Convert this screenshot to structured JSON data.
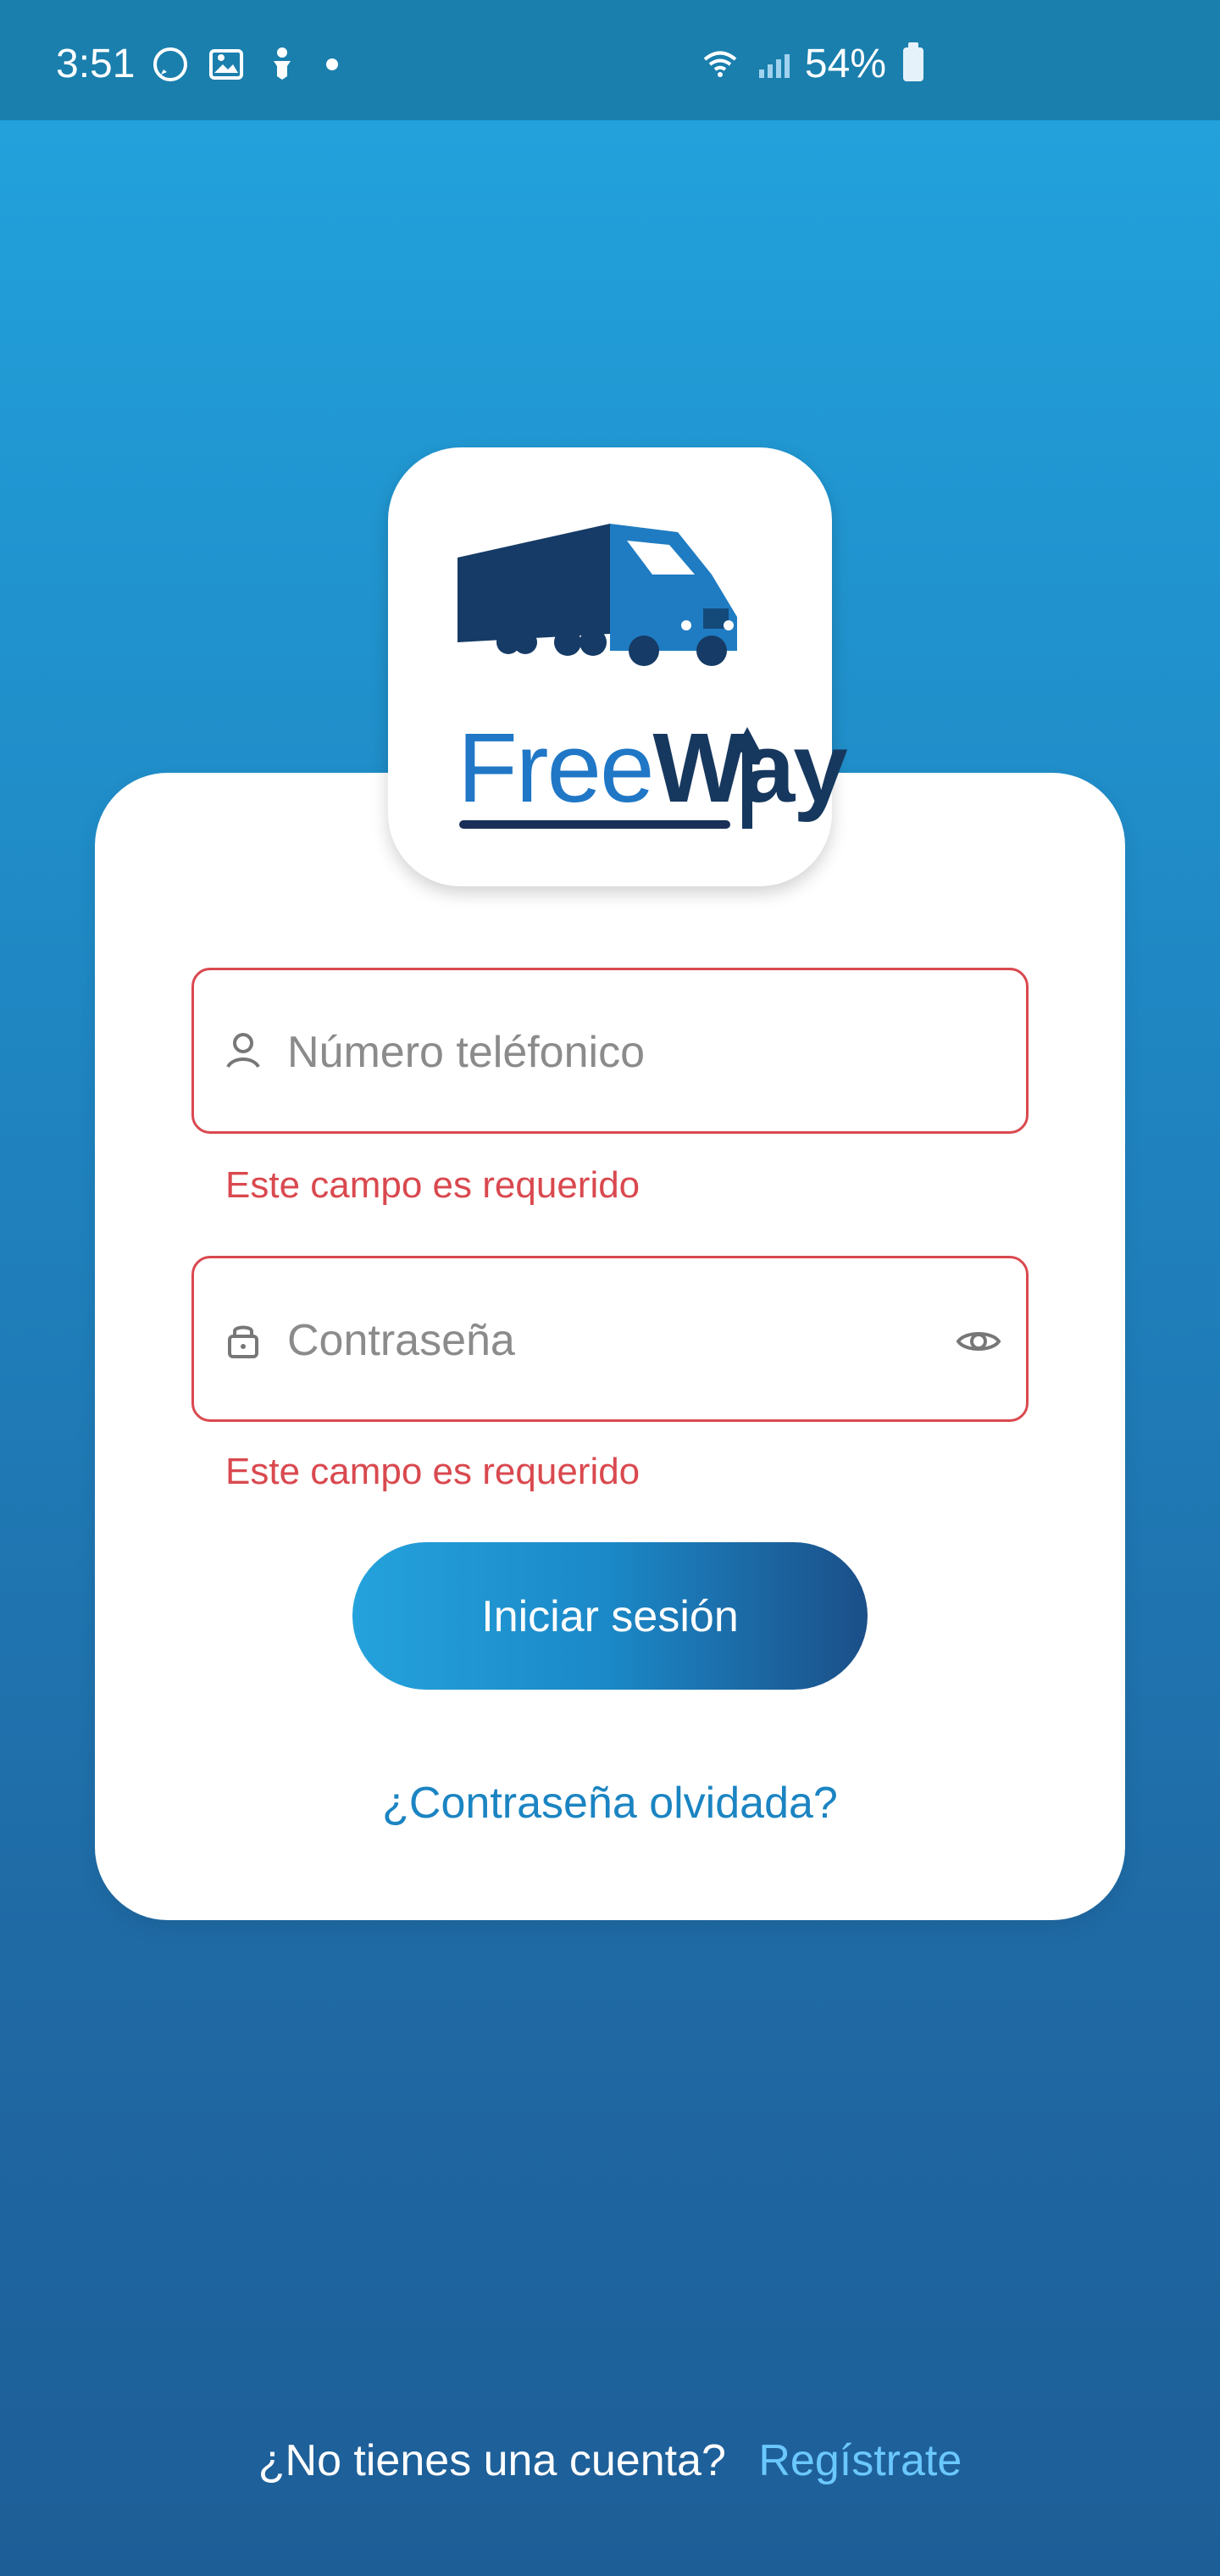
{
  "status_bar": {
    "time": "3:51",
    "battery": "54%"
  },
  "brand": {
    "free": "Free",
    "way": "Way"
  },
  "form": {
    "phone_placeholder": "Número teléfonico",
    "password_placeholder": "Contraseña",
    "required_error": "Este campo es requerido",
    "login_label": "Iniciar sesión",
    "forgot_label": "¿Contraseña olvidada?"
  },
  "footer": {
    "no_account_text": "¿No tienes una cuenta?",
    "register_label": "Regístrate"
  },
  "colors": {
    "primary": "#1f86c2",
    "error": "#d9494f",
    "link": "#1b84c2"
  }
}
